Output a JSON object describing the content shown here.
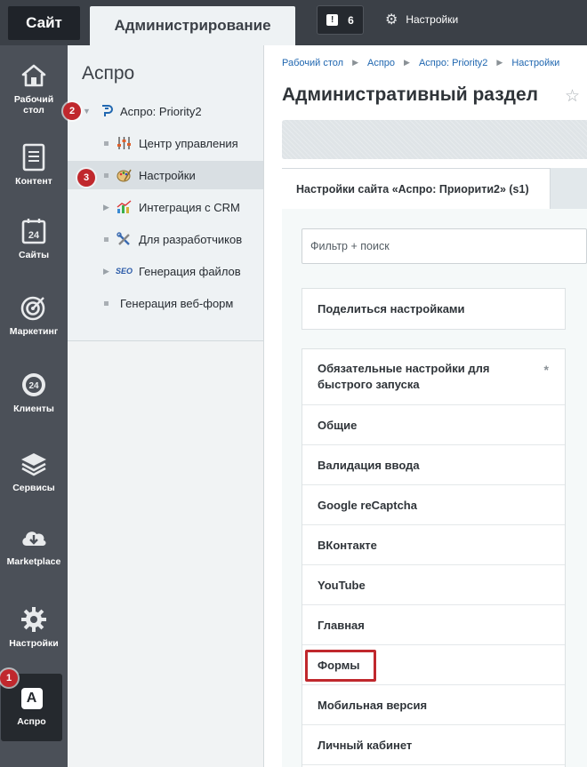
{
  "topbar": {
    "site_tab": "Сайт",
    "admin_tab": "Администрирование",
    "notifications_count": "6",
    "settings_label": "Настройки"
  },
  "leftnav": {
    "items": [
      {
        "label_line1": "Рабочий",
        "label_line2": "стол",
        "icon": "home-icon"
      },
      {
        "label_line1": "Контент",
        "label_line2": "",
        "icon": "document-icon"
      },
      {
        "label_line1": "Сайты",
        "label_line2": "",
        "icon": "calendar-24-icon"
      },
      {
        "label_line1": "Маркетинг",
        "label_line2": "",
        "icon": "target-icon"
      },
      {
        "label_line1": "Клиенты",
        "label_line2": "",
        "icon": "clients-24-icon"
      },
      {
        "label_line1": "Сервисы",
        "label_line2": "",
        "icon": "layers-icon"
      },
      {
        "label_line1": "Marketplace",
        "label_line2": "",
        "icon": "cloud-download-icon"
      },
      {
        "label_line1": "Настройки",
        "label_line2": "",
        "icon": "gear-icon"
      },
      {
        "label_line1": "Аспро",
        "label_line2": "",
        "icon": "aspro-icon",
        "badge": "A"
      }
    ]
  },
  "panel": {
    "title": "Аспро",
    "tree": [
      {
        "label": "Аспро: Priority2",
        "icon": "priority-logo-icon"
      },
      {
        "label": "Центр управления",
        "icon": "sliders-icon"
      },
      {
        "label": "Настройки",
        "icon": "palette-icon"
      },
      {
        "label": "Интеграция с CRM",
        "icon": "chart-icon"
      },
      {
        "label": "Для разработчиков",
        "icon": "tools-icon"
      },
      {
        "label": "Генерация файлов",
        "icon": "seo-icon",
        "icon_text": "SEO"
      },
      {
        "label": "Генерация веб-форм",
        "icon": ""
      }
    ]
  },
  "markers": [
    "1",
    "2",
    "3"
  ],
  "main": {
    "breadcrumb": [
      "Рабочий стол",
      "Аспро",
      "Аспро: Priority2",
      "Настройки"
    ],
    "title": "Административный раздел",
    "tab": "Настройки сайта «Аспро: Приорити2» (s1)",
    "filter_placeholder": "Фильтр + поиск",
    "share": "Поделиться настройками",
    "required_mark": "*",
    "sections": [
      "Обязательные настройки для быстрого запуска",
      "Общие",
      "Валидация ввода",
      "Google reCaptcha",
      "ВКонтакте",
      "YouTube",
      "Главная",
      "Формы",
      "Мобильная версия",
      "Личный кабинет"
    ]
  },
  "colors": {
    "topbar": "#3b4047",
    "leftnav": "#4b5058",
    "marker": "#c0282d",
    "link": "#2067b0"
  }
}
